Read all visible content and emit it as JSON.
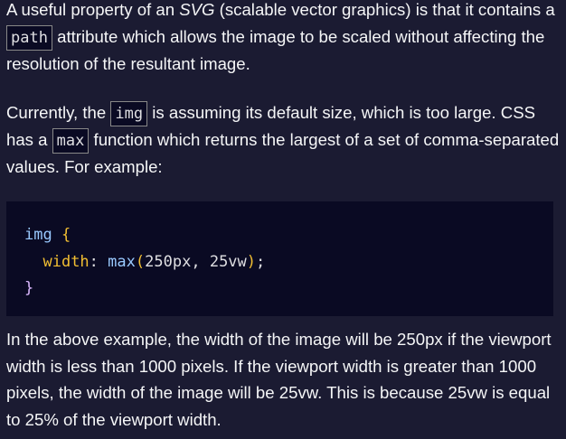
{
  "para1": {
    "t1": "A useful property of an ",
    "svg": "SVG",
    "t2": " (scalable vector graphics) is that it contains a ",
    "code": "path",
    "t3": " attribute which allows the image to be scaled without affecting the resolution of the resultant image."
  },
  "para2": {
    "t1": "Currently, the ",
    "code1": "img",
    "t2": " is assuming its default size, which is too large. CSS has a ",
    "code2": "max",
    "t3": " function which returns the largest of a set of comma-separated values. For example:"
  },
  "codeblock": {
    "selector": "img",
    "open_brace": "{",
    "property": "width",
    "colon": ":",
    "function": "max",
    "open_paren": "(",
    "arg1": "250px",
    "comma": ",",
    "arg2": "25vw",
    "close_paren": ")",
    "semicolon": ";",
    "close_brace": "}"
  },
  "para3": {
    "text": "In the above example, the width of the image will be 250px if the viewport width is less than 1000 pixels. If the viewport width is greater than 1000 pixels, the width of the image will be 25vw. This is because 25vw is equal to 25% of the viewport width."
  },
  "colors": {
    "background": "#1b1b32",
    "code_background": "#0a0a23",
    "text": "#f5f6f7",
    "selector": "#99c9ff",
    "property": "#f1be32",
    "close_brace": "#dbb8ff"
  }
}
